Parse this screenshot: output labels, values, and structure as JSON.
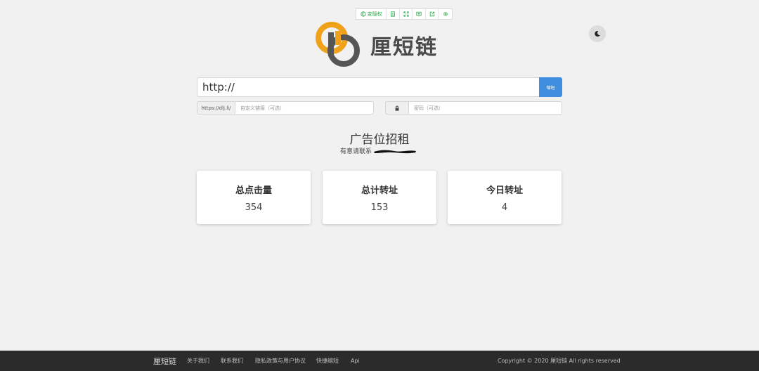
{
  "topbar": {
    "version_label": "变版权",
    "icons": [
      "ad-icon",
      "fullscreen-icon",
      "qrcode-icon",
      "share-icon",
      "settings-icon"
    ]
  },
  "logo": {
    "text": "厘短链"
  },
  "theme_toggle": {
    "icon": "moon-icon"
  },
  "shorten": {
    "url_value": "http://",
    "button_label": "缩短",
    "domain_prefix": "https://dlj.li/",
    "custom_placeholder": "自定义链接（可选）",
    "password_placeholder": "密码（可选）"
  },
  "ad": {
    "title": "广告位招租",
    "subtitle": "有意请联系"
  },
  "stats": [
    {
      "label": "总点击量",
      "value": "354"
    },
    {
      "label": "总计转址",
      "value": "153"
    },
    {
      "label": "今日转址",
      "value": "4"
    }
  ],
  "footer": {
    "brand": "厘短链",
    "links": [
      "关于我们",
      "联系我们",
      "隐私政策与用户协议",
      "快捷缩短",
      "Api"
    ],
    "copyright": "Copyright © 2020 厘短链 All rights reserved"
  },
  "colors": {
    "accent_green": "#2aa84a",
    "button_blue": "#3e8fe0",
    "logo_orange": "#f0a11a",
    "logo_dark": "#555555",
    "footer_bg": "#2b2b2b"
  }
}
